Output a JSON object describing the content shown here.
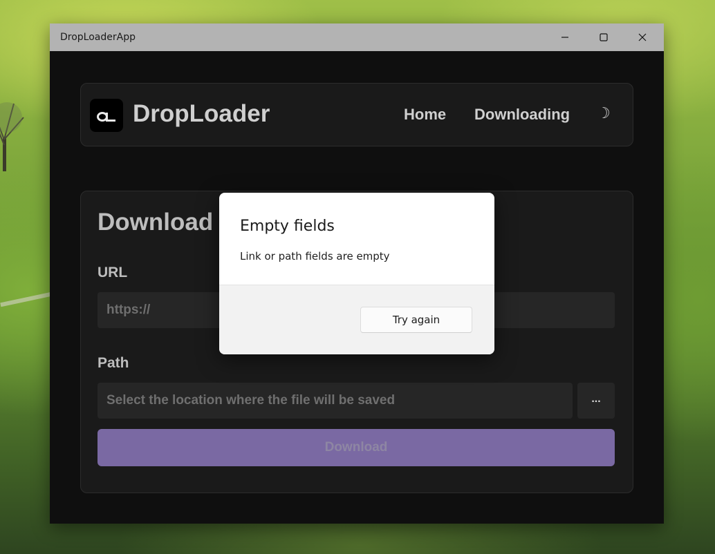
{
  "window": {
    "title": "DropLoaderApp"
  },
  "header": {
    "logo_text": "dL",
    "brand": "DropLoader",
    "nav": {
      "home": "Home",
      "downloading": "Downloading",
      "theme_icon": "☽"
    }
  },
  "card": {
    "title": "Download",
    "url_label": "URL",
    "url_placeholder": "https://",
    "path_label": "Path",
    "path_placeholder": "Select the location where the file will be saved",
    "browse_label": "...",
    "download_label": "Download"
  },
  "dialog": {
    "title": "Empty fields",
    "message": "Link or path fields are empty",
    "button": "Try again"
  },
  "icons": {
    "minimize": "minimize-icon",
    "maximize": "maximize-icon",
    "close": "close-icon",
    "theme": "moon-icon"
  },
  "colors": {
    "window_bg": "#0f0f0f",
    "panel_bg": "#1a1a1a",
    "accent": "#7a69a3",
    "titlebar": "#b3b3b3"
  }
}
